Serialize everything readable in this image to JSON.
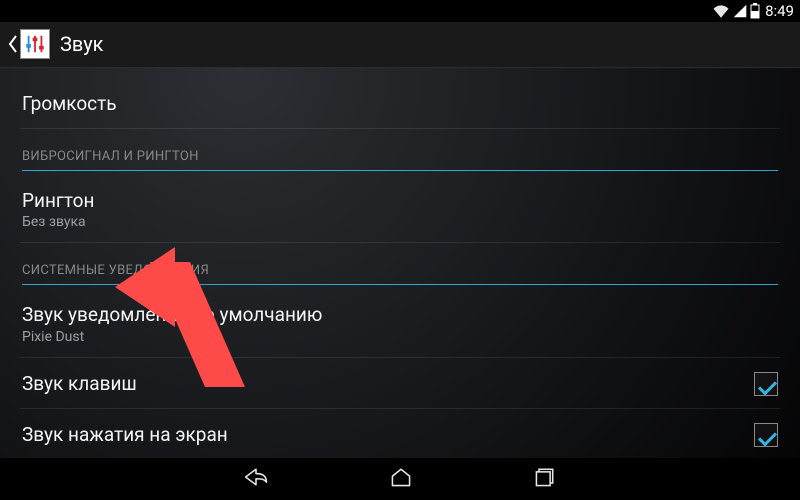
{
  "statusbar": {
    "time": "8:49"
  },
  "actionbar": {
    "title": "Звук"
  },
  "list": {
    "volume_label": "Громкость",
    "cat_vibrate_ringtone": "ВИБРОСИГНАЛ И РИНГТОН",
    "ringtone": {
      "title": "Рингтон",
      "summary": "Без звука"
    },
    "cat_system": "СИСТЕМНЫЕ УВЕДОМЛЕНИЯ",
    "notif_sound": {
      "title": "Звук уведомлений по умолчанию",
      "summary": "Pixie Dust"
    },
    "key_sound_label": "Звук клавиш",
    "touch_sound_label": "Звук нажатия на экран"
  }
}
